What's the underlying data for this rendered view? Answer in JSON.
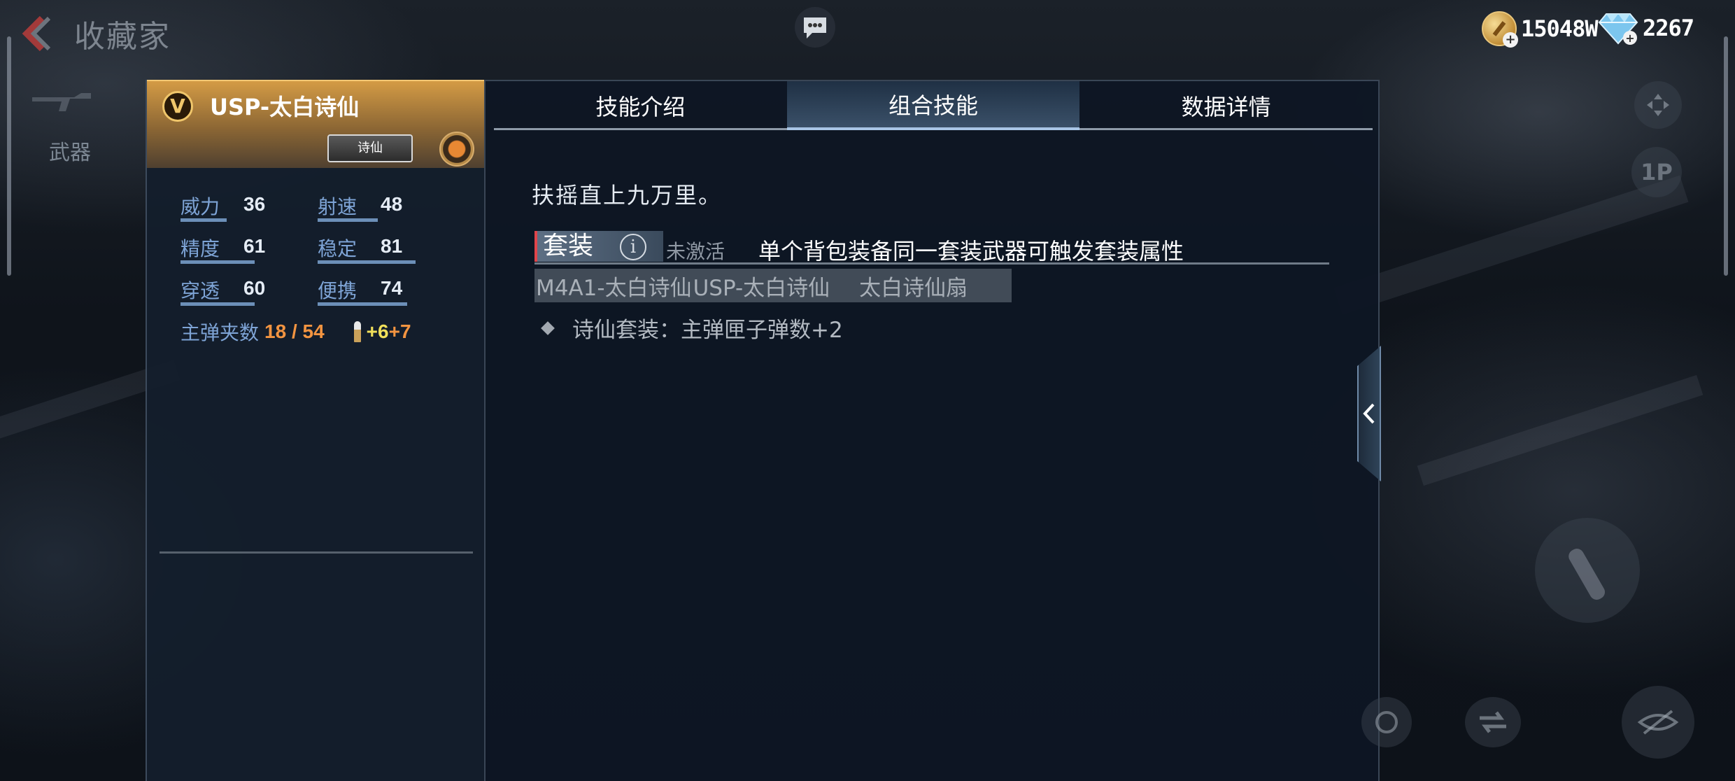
{
  "header": {
    "title": "收藏家",
    "gold_amount": "15048W",
    "diamond_amount": "2267"
  },
  "left_nav": {
    "weapon_label": "武器"
  },
  "weapon": {
    "rank": "V",
    "name": "USP-太白诗仙",
    "tag": "诗仙",
    "stats": [
      {
        "label": "威力",
        "value": "36",
        "level": 0.36
      },
      {
        "label": "射速",
        "value": "48",
        "level": 0.48
      },
      {
        "label": "精度",
        "value": "61",
        "level": 0.61
      },
      {
        "label": "稳定",
        "value": "81",
        "level": 0.81
      },
      {
        "label": "穿透",
        "value": "60",
        "level": 0.6
      },
      {
        "label": "便携",
        "value": "74",
        "level": 0.74
      }
    ],
    "magazine_label": "主弹夹数",
    "magazine_value": "18 / 54",
    "bonus_a": "+6",
    "bonus_b": "+7"
  },
  "tabs": [
    {
      "label": "技能介绍",
      "active": false
    },
    {
      "label": "组合技能",
      "active": true
    },
    {
      "label": "数据详情",
      "active": false
    }
  ],
  "combo": {
    "motto": "扶摇直上九万里。",
    "set_label": "套装",
    "set_status": "未激活",
    "set_description": "单个背包装备同一套装武器可触发套装属性",
    "set_weapons": [
      "M4A1-太白诗仙",
      "USP-太白诗仙",
      "太白诗仙扇"
    ],
    "bonus_text": "诗仙套装：主弹匣子弹数+2"
  },
  "side_buttons": {
    "view_label": "1P"
  },
  "colors": {
    "accent_gold": "#d49b45",
    "stat_blue": "#7ea4d6",
    "orange": "#f29441",
    "yellow": "#f1e05a",
    "set_red": "#e0454b"
  }
}
